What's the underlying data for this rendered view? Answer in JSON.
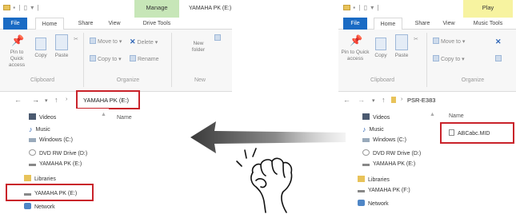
{
  "left_window": {
    "quick_access": "▪ | ▯ ▾ |",
    "context_tab": "Manage",
    "title": "YAMAHA PK (E:)",
    "tabs": [
      "File",
      "Home",
      "Share",
      "View",
      "Drive Tools"
    ],
    "ribbon": {
      "pin_label": "Pin to Quick access",
      "copy_label": "Copy",
      "paste_label": "Paste",
      "move_to": "Move to ▾",
      "delete": "Delete ▾",
      "copy_to": "Copy to ▾",
      "rename": "Rename",
      "new_folder": "New folder",
      "group_clipboard": "Clipboard",
      "group_organize": "Organize",
      "group_new": "New"
    },
    "address": "YAMAHA PK (E:)",
    "nav_items": [
      "Videos",
      "Music",
      "Windows (C:)",
      "DVD RW Drive (D:)",
      "YAMAHA PK (E:)",
      "Libraries",
      "YAMAHA PK (E:)",
      "Network"
    ],
    "column_header": "Name"
  },
  "right_window": {
    "quick_access": "▪ | ▯ ▾ |",
    "context_tab": "Play",
    "tabs": [
      "File",
      "Home",
      "Share",
      "View",
      "Music Tools"
    ],
    "ribbon": {
      "pin_label": "Pin to Quick access",
      "copy_label": "Copy",
      "paste_label": "Paste",
      "move_to": "Move to ▾",
      "copy_to": "Copy to ▾",
      "group_clipboard": "Clipboard",
      "group_organize": "Organize"
    },
    "address": "PSR-E383",
    "nav_items": [
      "Videos",
      "Music",
      "Windows (C:)",
      "DVD RW Drive (D:)",
      "YAMAHA PK (E:)",
      "Libraries",
      "YAMAHA PK (F:)",
      "Network"
    ],
    "column_header": "Name",
    "file_name": "ABCabc.MID"
  },
  "colors": {
    "highlight": "#c9222a",
    "file_tab": "#1a6bc4",
    "manage_tab": "#c7e6b8",
    "play_tab": "#f7f3a0"
  }
}
